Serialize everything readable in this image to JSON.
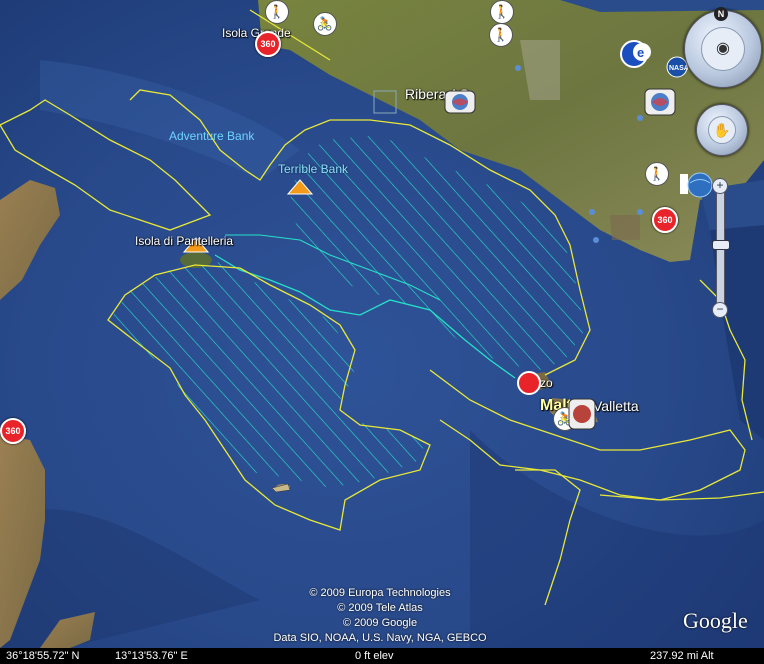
{
  "map": {
    "labels": {
      "isola_grande": "Isola Grande",
      "ribera": "Ribera AG",
      "adventure_bank": "Adventure Bank",
      "terrible_bank": "Terrible Bank",
      "pantelleria": "Isola di Pantelleria",
      "gozo": "Gozo",
      "malta": "Malta",
      "valletta": "Valletta"
    },
    "poi_360_text": "360",
    "copyright": {
      "line1": "© 2009 Europa Technologies",
      "line2": "© 2009 Tele Atlas",
      "line3": "© 2009 Google",
      "line4": "Data SIO, NOAA, U.S. Navy, NGA, GEBCO"
    },
    "google_logo": "Google",
    "colors": {
      "sea": "#2a4c8a",
      "land": "#6b7a3e",
      "border_line": "#e8e838",
      "hatch": "#27e0c8"
    }
  },
  "status": {
    "lat": "36°18'55.72\" N",
    "lon": "13°13'53.76\" E",
    "elev": "0 ft elev",
    "alt": "237.92 mi Alt"
  },
  "nav": {
    "north": "N",
    "zoom_in": "+",
    "zoom_out": "−",
    "zoom_level": 0.47
  }
}
